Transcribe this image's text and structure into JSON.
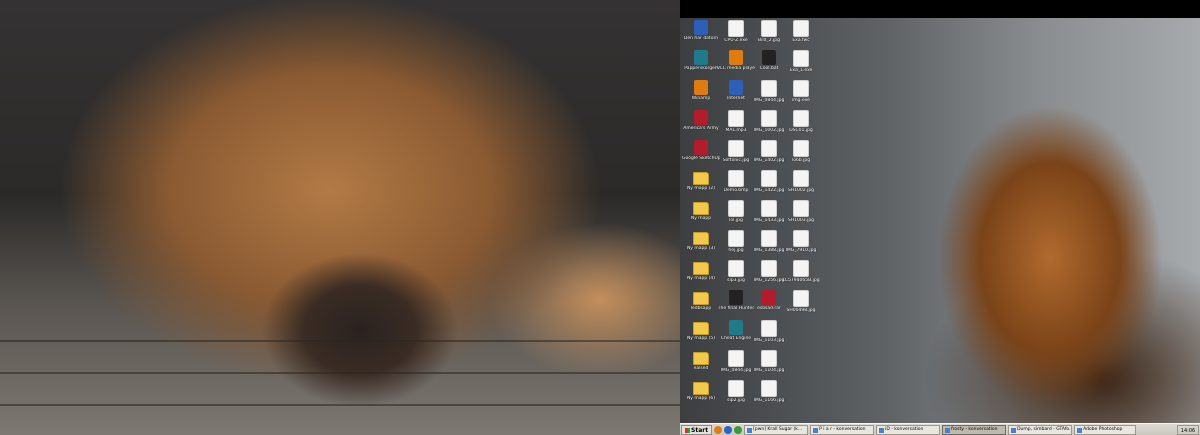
{
  "colors": {
    "taskbar": "#d4d0c8",
    "folder": "#f2c94c",
    "start_text": "#000000"
  },
  "desktop": {
    "icons": [
      [
        "Den här datorn",
        "Papperskorgen",
        "Winamp",
        "America's Army",
        "Google SketchUp",
        "Ny mapp (2)",
        "Ny mapp",
        "Ny mapp (3)",
        "Ny mapp (4)",
        "ledbsapp",
        "Ny mapp (5)",
        "ealsed",
        "Ny mapp (6)"
      ],
      [
        "CPU-Z.exe",
        "VLC media player",
        "Internet",
        "MAL.mp3",
        "Softonic.jpg",
        "Demo.bmp",
        "lol.jpg",
        "hej.jpg",
        "sip3.jpg",
        "The final Hunter",
        "Cheat Engine",
        "IMG_0844.jpg",
        "sip2.jpg"
      ],
      [
        "Bild_2.jpg",
        "Cool.bat",
        "IMG_0844.jpg",
        "IMG_1002.jpg",
        "IMG_1402.jpg",
        "IMG_1422.jpg",
        "IMG_1433.jpg",
        "IMG_1388.jpg",
        "IMG_1256.jpg",
        "esbsad.rar",
        "IMG_1103.jpg",
        "IMG_1104.jpg",
        "IMG_1166.jpg"
      ],
      [
        "Exa.fwc",
        "Exa_1.exe",
        "img.exe",
        "DSC01.jpg",
        "lo6b.jpg",
        "SH1002.jpg",
        "SH1003.jpg",
        "IMG_7910.jpg",
        "LC5794065B.jpg",
        "SH00498.jpg"
      ]
    ]
  },
  "taskbar": {
    "start_label": "Start",
    "tasks": [
      {
        "label": "[pwn] Krall Sugar (k...",
        "active": false
      },
      {
        "label": "P i a r - konversation",
        "active": false
      },
      {
        "label": "iD - konversation",
        "active": false
      },
      {
        "label": "frosty - konversation",
        "active": true
      },
      {
        "label": "Dump, simbard - GTAfo...",
        "active": false
      },
      {
        "label": "Adobe Photoshop",
        "active": false
      }
    ],
    "clock": "14:06"
  }
}
